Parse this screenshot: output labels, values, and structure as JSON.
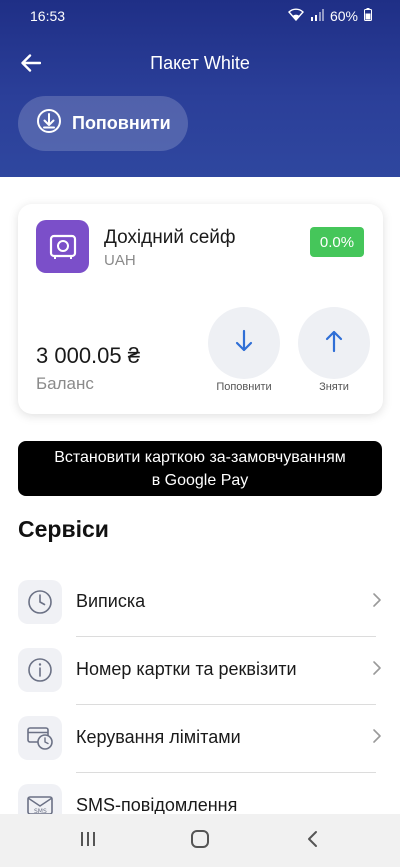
{
  "status_bar": {
    "time": "16:53",
    "battery": "60%",
    "icons": [
      "wifi-icon",
      "signal-icon",
      "battery-icon"
    ]
  },
  "header": {
    "title": "Пакет White",
    "back_icon": "arrow-left-icon",
    "topup_label": "Поповнити",
    "topup_icon": "download-circle-icon"
  },
  "card": {
    "icon": "safe-icon",
    "title": "Дохідний сейф",
    "currency": "UAH",
    "rate": "0.0%",
    "balance_amount": "3 000.05 ₴",
    "balance_label": "Баланс",
    "topup_label": "Поповнити",
    "withdraw_label": "Зняти"
  },
  "gpay_banner": {
    "line1": "Встановити карткою за-замовчуванням",
    "line2": "в Google Pay"
  },
  "services": {
    "title": "Сервіси",
    "items": [
      {
        "label": "Виписка",
        "icon": "clock-icon"
      },
      {
        "label": "Номер картки та реквізити",
        "icon": "info-icon"
      },
      {
        "label": "Керування лімітами",
        "icon": "card-limit-icon"
      },
      {
        "label": "SMS-повідомлення",
        "icon": "sms-icon",
        "icon_text": "SMS"
      }
    ]
  },
  "colors": {
    "header_bg": "#2b3f99",
    "safe_icon_bg": "#7b4fc9",
    "rate_badge_bg": "#45c65a",
    "action_arrow": "#2f6fd6"
  },
  "nav": {
    "icons": [
      "recents-icon",
      "home-icon",
      "back-icon"
    ]
  }
}
